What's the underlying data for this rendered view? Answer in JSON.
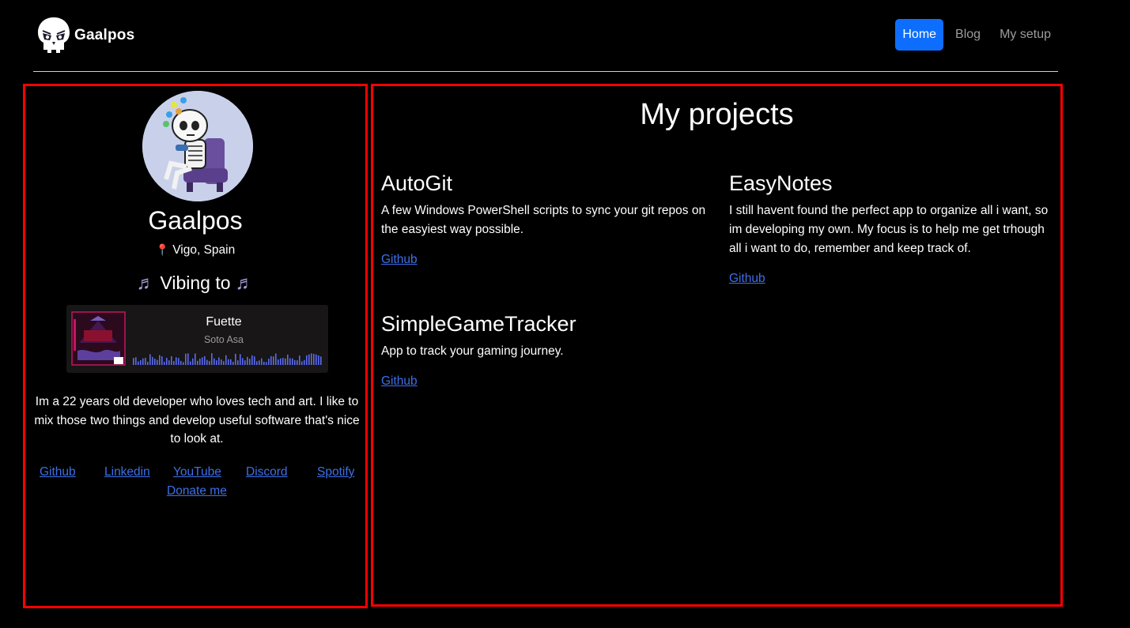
{
  "brand": {
    "name": "Gaalpos",
    "logo_icon": "skull-logo-icon"
  },
  "nav": {
    "items": [
      {
        "label": "Home",
        "active": true
      },
      {
        "label": "Blog",
        "active": false
      },
      {
        "label": "My setup",
        "active": false
      }
    ]
  },
  "profile": {
    "name": "Gaalpos",
    "avatar_icon": "skeleton-gamer-avatar",
    "location": "Vigo, Spain",
    "location_icon": "map-pin-icon",
    "vibing_label": "Vibing to",
    "vibing_icon": "music-note-icon",
    "bio": "Im a 22 years old developer who loves tech and art. I like to mix those two things and develop useful software that's nice to look at."
  },
  "player": {
    "track": "Fuette",
    "artist": "Soto Asa",
    "waveform_color": "#5a6cf0"
  },
  "socials": {
    "items": [
      {
        "label": "Github"
      },
      {
        "label": "Linkedin"
      },
      {
        "label": "YouTube"
      },
      {
        "label": "Discord"
      },
      {
        "label": "Spotify"
      },
      {
        "label": "Donate me"
      }
    ]
  },
  "projects": {
    "title": "My projects",
    "items": [
      {
        "name": "AutoGit",
        "description": "A few Windows PowerShell scripts to sync your git repos on the easyiest way possible.",
        "link": "Github"
      },
      {
        "name": "EasyNotes",
        "description": "I still havent found the perfect app to organize all i want, so im developing my own. My focus is to help me get trhough all i want to do, remember and keep track of.",
        "link": "Github"
      },
      {
        "name": "SimpleGameTracker",
        "description": "App to track your gaming journey.",
        "link": "Github"
      }
    ]
  },
  "colors": {
    "background": "#000000",
    "accent": "#0d6efd",
    "link": "#3d6fe9",
    "panel_border": "#ff0000"
  }
}
